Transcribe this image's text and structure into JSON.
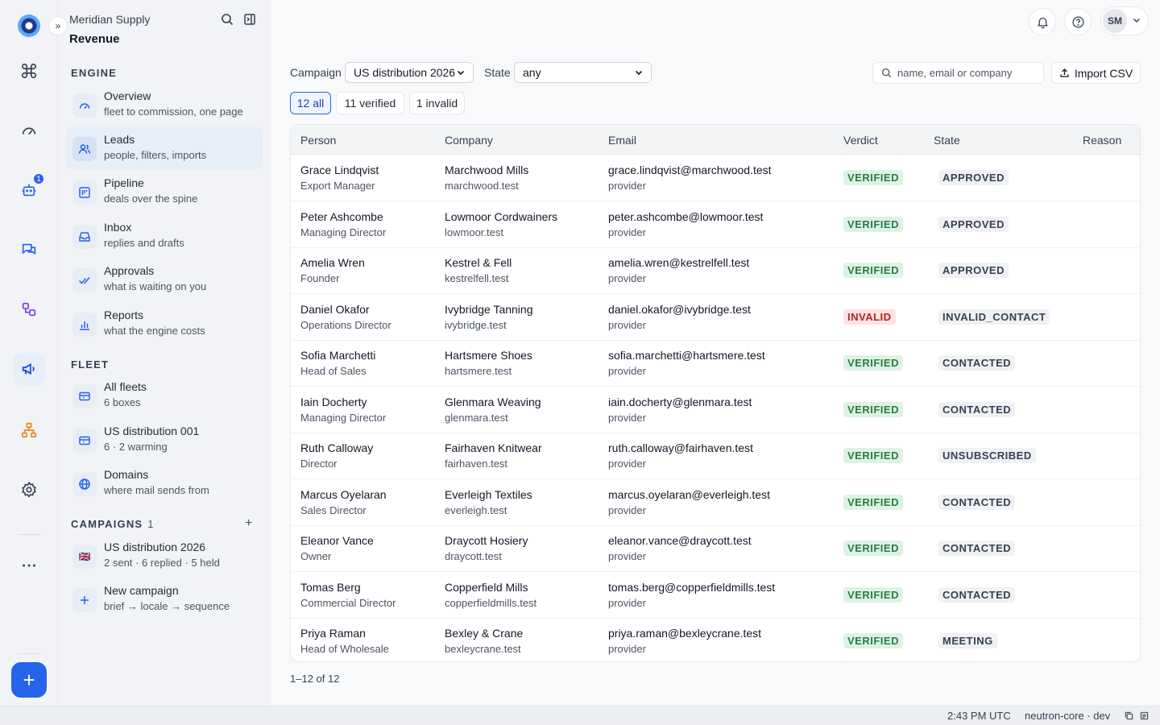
{
  "org": {
    "name": "Meridian Supply",
    "workspace": "Revenue"
  },
  "rail": {
    "inbox_badge": "1"
  },
  "sections": {
    "engine": "ENGINE",
    "fleet": "FLEET",
    "campaigns": "CAMPAIGNS",
    "campaigns_count": "1"
  },
  "nav": {
    "overview": {
      "title": "Overview",
      "sub": "fleet to commission, one page"
    },
    "leads": {
      "title": "Leads",
      "sub": "people, filters, imports"
    },
    "pipeline": {
      "title": "Pipeline",
      "sub": "deals over the spine"
    },
    "inbox": {
      "title": "Inbox",
      "sub": "replies and drafts"
    },
    "approvals": {
      "title": "Approvals",
      "sub": "what is waiting on you"
    },
    "reports": {
      "title": "Reports",
      "sub": "what the engine costs"
    },
    "all_fleets": {
      "title": "All fleets",
      "sub": "6 boxes"
    },
    "us_dist_001": {
      "title": "US distribution 001",
      "sub": "6 · 2 warming"
    },
    "domains": {
      "title": "Domains",
      "sub": "where mail sends from"
    },
    "us_dist_2026": {
      "title": "US distribution 2026",
      "sub": "2 sent · 6 replied · 5 held",
      "flag": "🇬🇧"
    },
    "new_campaign": {
      "title": "New campaign",
      "sub": "brief → locale → sequence"
    }
  },
  "header": {
    "avatar_initials": "SM"
  },
  "filters": {
    "campaign_label": "Campaign",
    "campaign_value": "US distribution 2026",
    "state_label": "State",
    "state_value": "any",
    "search_placeholder": "name, email or company",
    "import_label": "Import CSV"
  },
  "chips": {
    "all": "12 all",
    "verified": "11 verified",
    "invalid": "1 invalid"
  },
  "table": {
    "headers": {
      "person": "Person",
      "company": "Company",
      "email": "Email",
      "verdict": "Verdict",
      "state": "State",
      "reason": "Reason"
    },
    "rows": [
      {
        "name": "Grace Lindqvist",
        "title": "Export Manager",
        "company": "Marchwood Mills",
        "domain": "marchwood.test",
        "email": "grace.lindqvist@marchwood.test",
        "source": "provider",
        "verdict": "VERIFIED",
        "state": "APPROVED"
      },
      {
        "name": "Peter Ashcombe",
        "title": "Managing Director",
        "company": "Lowmoor Cordwainers",
        "domain": "lowmoor.test",
        "email": "peter.ashcombe@lowmoor.test",
        "source": "provider",
        "verdict": "VERIFIED",
        "state": "APPROVED"
      },
      {
        "name": "Amelia Wren",
        "title": "Founder",
        "company": "Kestrel & Fell",
        "domain": "kestrelfell.test",
        "email": "amelia.wren@kestrelfell.test",
        "source": "provider",
        "verdict": "VERIFIED",
        "state": "APPROVED"
      },
      {
        "name": "Daniel Okafor",
        "title": "Operations Director",
        "company": "Ivybridge Tanning",
        "domain": "ivybridge.test",
        "email": "daniel.okafor@ivybridge.test",
        "source": "provider",
        "verdict": "INVALID",
        "state": "INVALID_CONTACT"
      },
      {
        "name": "Sofia Marchetti",
        "title": "Head of Sales",
        "company": "Hartsmere Shoes",
        "domain": "hartsmere.test",
        "email": "sofia.marchetti@hartsmere.test",
        "source": "provider",
        "verdict": "VERIFIED",
        "state": "CONTACTED"
      },
      {
        "name": "Iain Docherty",
        "title": "Managing Director",
        "company": "Glenmara Weaving",
        "domain": "glenmara.test",
        "email": "iain.docherty@glenmara.test",
        "source": "provider",
        "verdict": "VERIFIED",
        "state": "CONTACTED"
      },
      {
        "name": "Ruth Calloway",
        "title": "Director",
        "company": "Fairhaven Knitwear",
        "domain": "fairhaven.test",
        "email": "ruth.calloway@fairhaven.test",
        "source": "provider",
        "verdict": "VERIFIED",
        "state": "UNSUBSCRIBED"
      },
      {
        "name": "Marcus Oyelaran",
        "title": "Sales Director",
        "company": "Everleigh Textiles",
        "domain": "everleigh.test",
        "email": "marcus.oyelaran@everleigh.test",
        "source": "provider",
        "verdict": "VERIFIED",
        "state": "CONTACTED"
      },
      {
        "name": "Eleanor Vance",
        "title": "Owner",
        "company": "Draycott Hosiery",
        "domain": "draycott.test",
        "email": "eleanor.vance@draycott.test",
        "source": "provider",
        "verdict": "VERIFIED",
        "state": "CONTACTED"
      },
      {
        "name": "Tomas Berg",
        "title": "Commercial Director",
        "company": "Copperfield Mills",
        "domain": "copperfieldmills.test",
        "email": "tomas.berg@copperfieldmills.test",
        "source": "provider",
        "verdict": "VERIFIED",
        "state": "CONTACTED"
      },
      {
        "name": "Priya Raman",
        "title": "Head of Wholesale",
        "company": "Bexley & Crane",
        "domain": "bexleycrane.test",
        "email": "priya.raman@bexleycrane.test",
        "source": "provider",
        "verdict": "VERIFIED",
        "state": "MEETING"
      }
    ]
  },
  "pager": "1–12 of 12",
  "status": {
    "time": "2:43 PM UTC",
    "env": "neutron-core · dev"
  },
  "colors": {
    "accent": "#2563eb",
    "verified_bg": "#dcf3e3",
    "verified_fg": "#2f7a45",
    "invalid_bg": "#fde2e2",
    "invalid_fg": "#b42323"
  }
}
